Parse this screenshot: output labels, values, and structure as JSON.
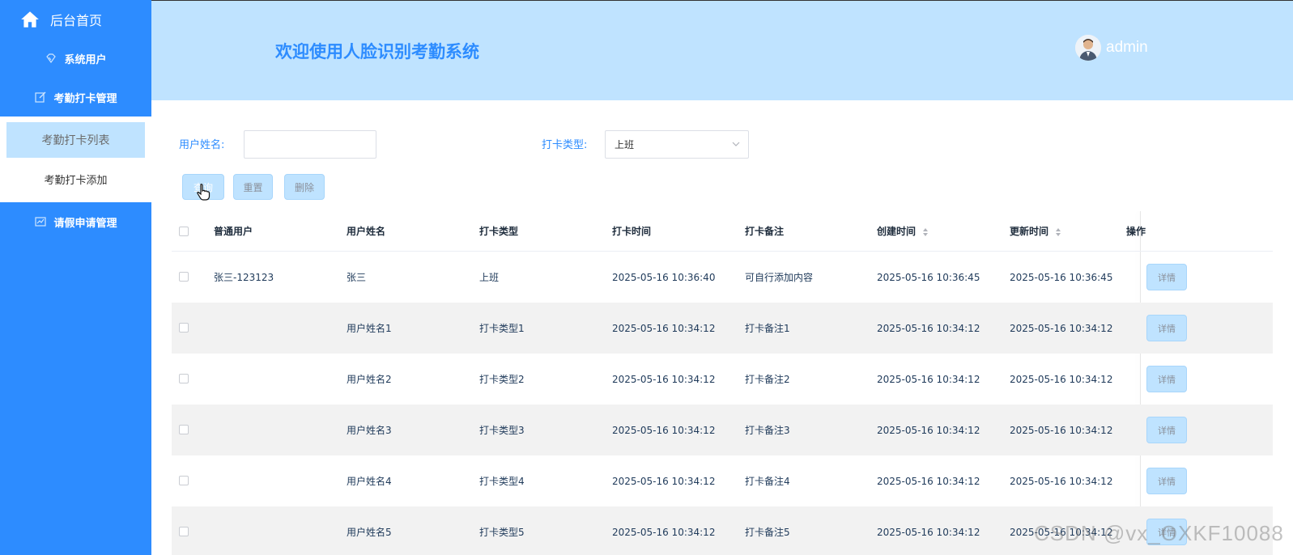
{
  "sidebar": {
    "home": "后台首页",
    "items": [
      {
        "label": "系统用户",
        "icon": "diamond-icon"
      },
      {
        "label": "考勤打卡管理",
        "icon": "edit-icon"
      },
      {
        "label": "请假申请管理",
        "icon": "chart-icon"
      }
    ],
    "submenu": [
      {
        "label": "考勤打卡列表",
        "active": true
      },
      {
        "label": "考勤打卡添加",
        "active": false
      }
    ]
  },
  "header": {
    "title": "欢迎使用人脸识别考勤系统",
    "user": "admin"
  },
  "filters": {
    "name_label": "用户姓名:",
    "name_value": "",
    "type_label": "打卡类型:",
    "type_value": "上班"
  },
  "buttons": {
    "query": "查询",
    "reset": "重置",
    "delete": "删除"
  },
  "table": {
    "headers": [
      "普通用户",
      "用户姓名",
      "打卡类型",
      "打卡时间",
      "打卡备注",
      "创建时间",
      "更新时间",
      "操作"
    ],
    "detail_label": "详情",
    "rows": [
      [
        "张三-123123",
        "张三",
        "上班",
        "2025-05-16 10:36:40",
        "可自行添加内容",
        "2025-05-16 10:36:45",
        "2025-05-16 10:36:45"
      ],
      [
        "",
        "用户姓名1",
        "打卡类型1",
        "2025-05-16 10:34:12",
        "打卡备注1",
        "2025-05-16 10:34:12",
        "2025-05-16 10:34:12"
      ],
      [
        "",
        "用户姓名2",
        "打卡类型2",
        "2025-05-16 10:34:12",
        "打卡备注2",
        "2025-05-16 10:34:12",
        "2025-05-16 10:34:12"
      ],
      [
        "",
        "用户姓名3",
        "打卡类型3",
        "2025-05-16 10:34:12",
        "打卡备注3",
        "2025-05-16 10:34:12",
        "2025-05-16 10:34:12"
      ],
      [
        "",
        "用户姓名4",
        "打卡类型4",
        "2025-05-16 10:34:12",
        "打卡备注4",
        "2025-05-16 10:34:12",
        "2025-05-16 10:34:12"
      ],
      [
        "",
        "用户姓名5",
        "打卡类型5",
        "2025-05-16 10:34:12",
        "打卡备注5",
        "2025-05-16 10:34:12",
        "2025-05-16 10:34:12"
      ]
    ]
  },
  "watermark": "CSDN @vx_OXKF10088",
  "colors": {
    "sidebar": "#2d8cff",
    "header": "#bfe3ff",
    "accent": "#2d8cff"
  }
}
